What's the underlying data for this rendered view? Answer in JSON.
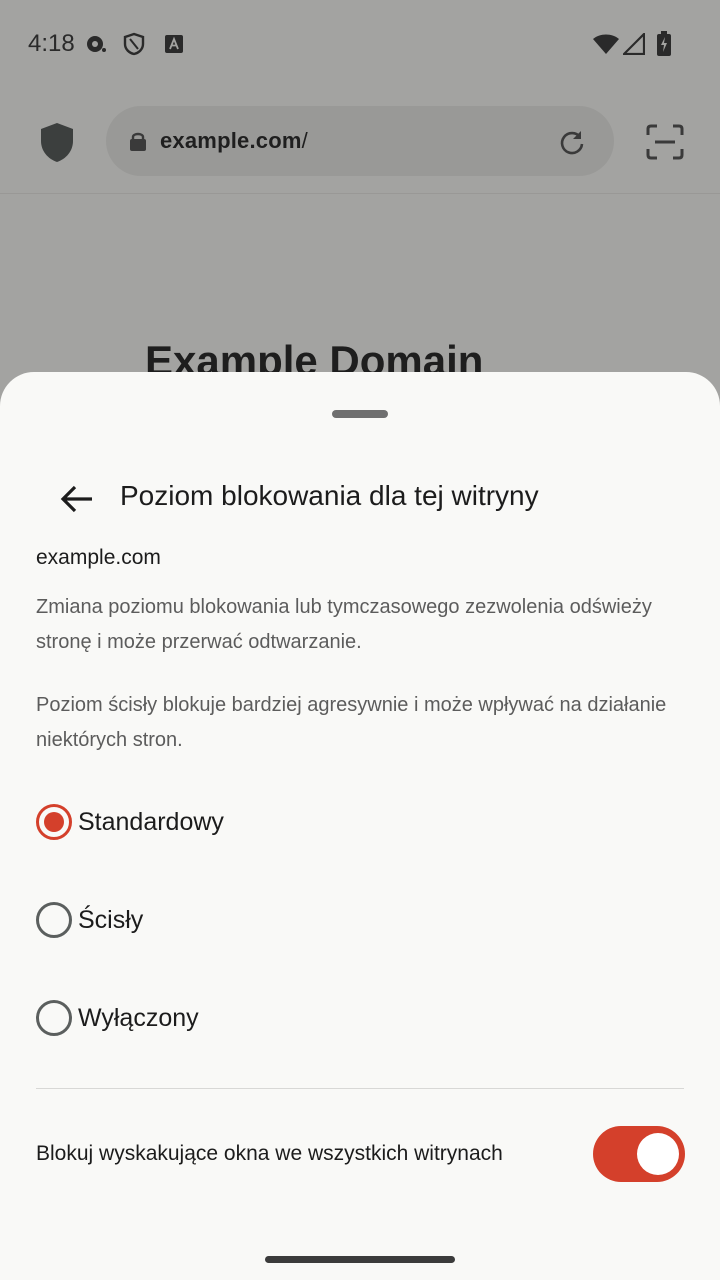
{
  "status_bar": {
    "time": "4:18",
    "icons": [
      "media-icon",
      "vpn-shield-icon",
      "font-app-icon",
      "wifi-icon",
      "signal-icon",
      "battery-charging-icon"
    ]
  },
  "toolbar": {
    "url_domain": "example.com",
    "url_path": "/",
    "icons": [
      "tracking-shield-icon",
      "lock-icon",
      "reload-icon",
      "qr-scan-icon"
    ]
  },
  "web_page": {
    "heading": "Example Domain"
  },
  "sheet": {
    "title": "Poziom blokowania dla tej witryny",
    "site": "example.com",
    "description_1": "Zmiana poziomu blokowania lub tymczasowego zezwolenia odświeży stronę i może przerwać odtwarzanie.",
    "description_2": "Poziom ścisły blokuje bardziej agresywnie i może wpływać na działanie niektórych stron.",
    "options": [
      {
        "label": "Standardowy",
        "selected": true
      },
      {
        "label": "Ścisły",
        "selected": false
      },
      {
        "label": "Wyłączony",
        "selected": false
      }
    ],
    "toggle": {
      "label": "Blokuj wyskakujące okna we wszystkich witrynach",
      "on": true
    }
  },
  "colors": {
    "accent": "#d4402b",
    "sheet_background": "#f9f9f7",
    "scrim": "#a3a3a1"
  }
}
